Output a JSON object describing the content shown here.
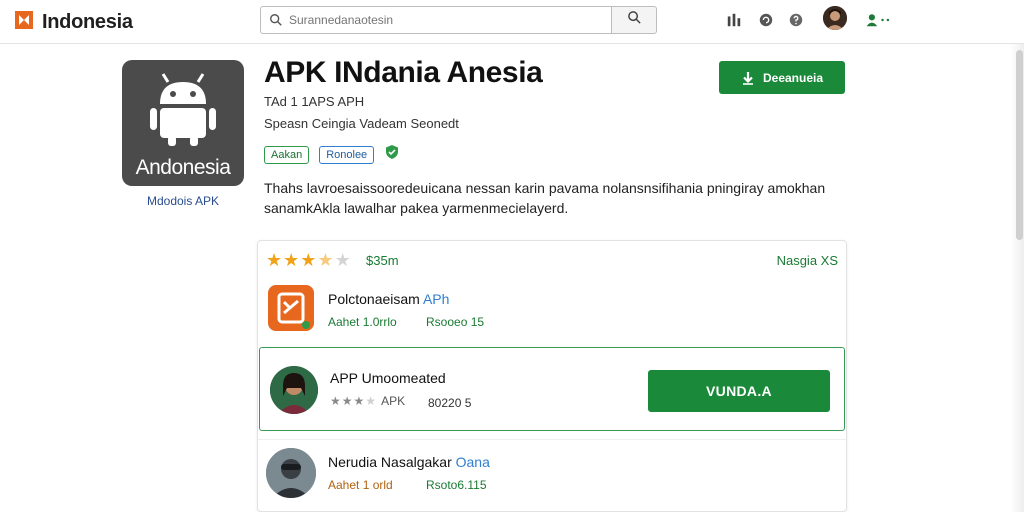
{
  "topbar": {
    "brand": "Indonesia",
    "search_placeholder": "Surannedanaotesin",
    "icons": [
      "tree-icon",
      "refresh-icon",
      "help-icon",
      "user-avatar",
      "account-menu-icon"
    ]
  },
  "app": {
    "icon_text": "Andonesia",
    "icon_caption": "Mdodois APK",
    "title": "APK INdania Anesia",
    "subtitle1": "TAd 1 1APS APH",
    "subtitle2": "Speasn Ceingia Vadeam Seonedt",
    "tag1": "Aakan",
    "tag2": "Ronolee",
    "description": "Thahs lavroesaissooredeuicana nessan karin pavama nolansnsifihania pningiray amokhan sanamkAkla lawalhar pakea yarmenmecielayerd.",
    "download_label": "Deeanueia"
  },
  "card": {
    "rating_value": 3.5,
    "rating_size": "$35m",
    "header_right": "Nasgia XS",
    "rows": [
      {
        "title": "Polctonaeisam",
        "title_accent": "APh",
        "meta1": "Aahet 1.0rrlo",
        "meta2": "Rsooeo 15"
      },
      {
        "title": "APP Umoomeated",
        "mini_stars": 3,
        "mini_label": "APK",
        "meta2": "80220 5",
        "button": "VUNDA.A"
      },
      {
        "title": "Nerudia Nasalgakar",
        "title_accent": "Oana",
        "meta1": "Aahet 1 orld",
        "meta2": "Rsoto6.115"
      }
    ]
  },
  "colors": {
    "accent_green": "#1a8a3a",
    "brand_orange": "#e8671e",
    "link_blue": "#2f7fd0",
    "star_gold": "#f0a21a"
  }
}
